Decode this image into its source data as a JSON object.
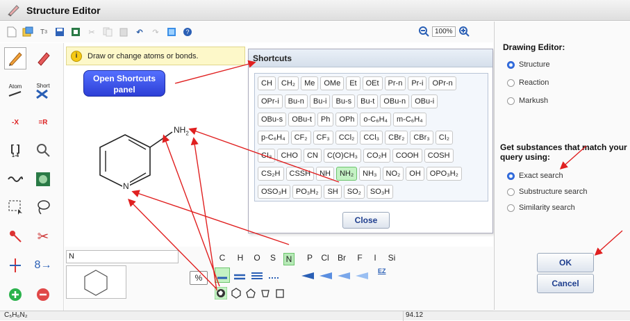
{
  "window": {
    "title": "Structure Editor"
  },
  "toolbar": {
    "zoom": "100%"
  },
  "hint": {
    "text": "Draw or change atoms or bonds."
  },
  "callout": {
    "text": "Open Shortcuts panel"
  },
  "left_palette": {
    "atom_label": "Atom",
    "short_label": "Short",
    "bracket_sub": "1-4"
  },
  "molecule": {
    "n_label": "N",
    "nh2_label": "NH"
  },
  "shortcuts": {
    "title": "Shortcuts",
    "close_label": "Close",
    "rows": [
      [
        "CH",
        "CH₂",
        "Me",
        "OMe",
        "Et",
        "OEt",
        "Pr-n",
        "Pr-i",
        "OPr-n"
      ],
      [
        "OPr-i",
        "Bu-n",
        "Bu-i",
        "Bu-s",
        "Bu-t",
        "OBu-n",
        "OBu-i"
      ],
      [
        "OBu-s",
        "OBu-t",
        "Ph",
        "OPh",
        "o-C₆H₄",
        "m-C₆H₄"
      ],
      [
        "p-C₆H₄",
        "CF₂",
        "CF₃",
        "CCl₂",
        "CCl₃",
        "CBr₂",
        "CBr₃",
        "CI₂"
      ],
      [
        "CI₃",
        "CHO",
        "CN",
        "C(O)CH₃",
        "CO₂H",
        "COOH",
        "COSH"
      ],
      [
        "CS₂H",
        "CSSH",
        "NH",
        "NH₂",
        "NH₃",
        "NO₂",
        "OH",
        "OPO₃H₂"
      ],
      [
        "OSO₃H",
        "PO₃H₂",
        "SH",
        "SO₂",
        "SO₃H"
      ]
    ],
    "highlighted": "NH₂"
  },
  "right_panel": {
    "drawing_editor_label": "Drawing Editor:",
    "editor_modes": [
      {
        "label": "Structure",
        "selected": true
      },
      {
        "label": "Reaction",
        "selected": false
      },
      {
        "label": "Markush",
        "selected": false
      }
    ],
    "query_heading": "Get substances that match your query using:",
    "search_types": [
      {
        "label": "Exact search",
        "selected": true
      },
      {
        "label": "Substructure search",
        "selected": false
      },
      {
        "label": "Similarity search",
        "selected": false
      }
    ],
    "ok_label": "OK",
    "cancel_label": "Cancel"
  },
  "bottom": {
    "formula_input": "N",
    "elements": [
      "C",
      "H",
      "O",
      "S",
      "N",
      "P",
      "Cl",
      "Br",
      "F",
      "I",
      "Si"
    ],
    "selected_element": "N",
    "percent": "%",
    "ez": "EZ"
  },
  "status": {
    "formula": "C₅H₆N₂",
    "mass": "94.12"
  },
  "colors": {
    "accent": "#2f6fe0",
    "annotation": "#e02020",
    "highlight": "#c4f2c4"
  }
}
